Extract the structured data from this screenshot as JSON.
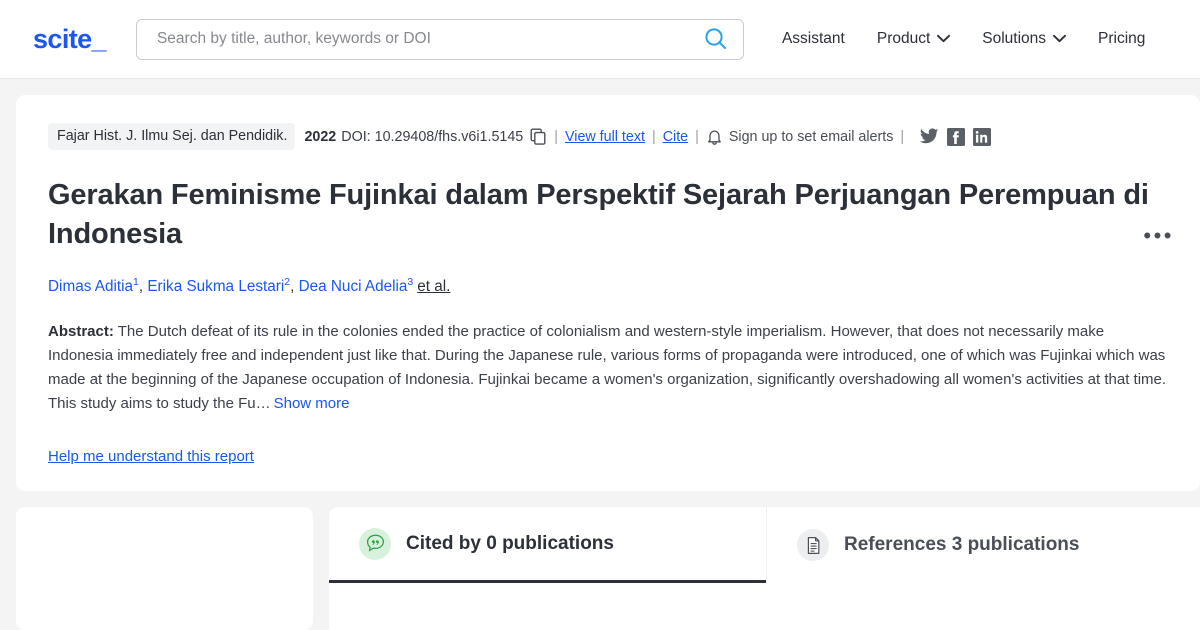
{
  "header": {
    "logo": "scite_",
    "search": {
      "placeholder": "Search by title, author, keywords or DOI",
      "value": "",
      "icon": "search-icon"
    },
    "nav": [
      {
        "label": "Assistant",
        "caret": false
      },
      {
        "label": "Product",
        "caret": true
      },
      {
        "label": "Solutions",
        "caret": true
      },
      {
        "label": "Pricing",
        "caret": false
      }
    ]
  },
  "article": {
    "journal": "Fajar Hist. J. Ilmu Sej. dan Pendidik.",
    "year": "2022",
    "doi": "DOI: 10.29408/fhs.v6i1.5145",
    "copy_icon": "copy-icon",
    "view_full_text": "View full text",
    "cite": "Cite",
    "alerts_icon": "bell-icon",
    "alerts_label": "Sign up to set email alerts",
    "separator": "|",
    "social": [
      "twitter-icon",
      "facebook-icon",
      "linkedin-icon"
    ],
    "kebab": "•••",
    "title": "Gerakan Feminisme Fujinkai dalam Perspektif Sejarah Perjuangan Perempuan di Indonesia",
    "authors": [
      {
        "name": "Dimas Aditia",
        "sup": "1"
      },
      {
        "name": "Erika Sukma Lestari",
        "sup": "2"
      },
      {
        "name": "Dea Nuci Adelia",
        "sup": "3"
      }
    ],
    "et_al": "et al.",
    "abstract_label": "Abstract:",
    "abstract_text": "The Dutch defeat of its rule in the colonies ended the practice of colonialism and western-style imperialism. However, that does not necessarily make Indonesia immediately free and independent just like that. During the Japanese rule, various forms of propaganda were introduced, one of which was Fujinkai which was made at the beginning of the Japanese occupation of Indonesia. Fujinkai became a women's organization, significantly overshadowing all women's activities at that time. This study aims to study the Fu…",
    "show_more": "Show more",
    "help_link": "Help me understand this report"
  },
  "tabs": [
    {
      "label": "Cited by 0 publications",
      "icon": "citation-quote-icon",
      "active": true
    },
    {
      "label": "References 3 publications",
      "icon": "document-icon",
      "active": false
    }
  ],
  "colors": {
    "brand_blue": "#1a56f0",
    "search_icon_blue": "#29a3e8",
    "text_dark": "#2c3038",
    "page_bg": "#f4f4f5",
    "badge_green": "#d8f1dc",
    "badge_green_fg": "#2f9e44"
  }
}
